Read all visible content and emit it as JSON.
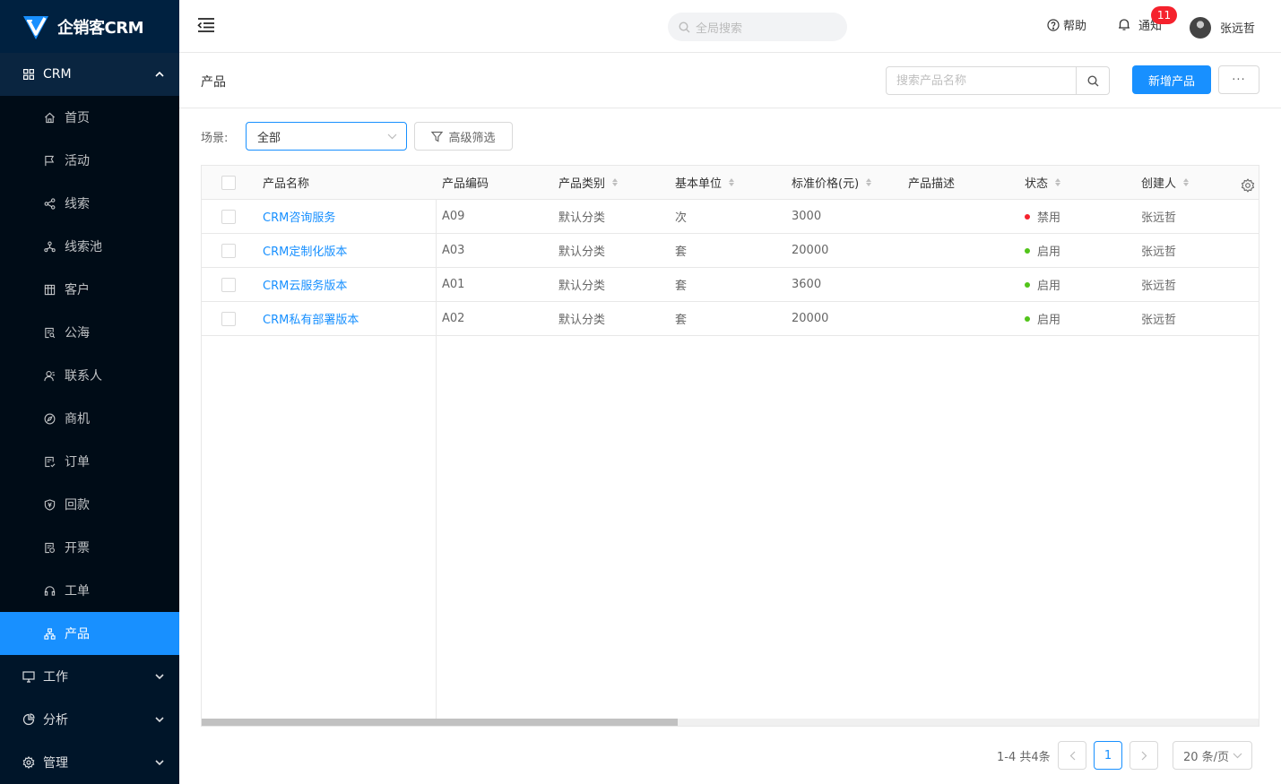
{
  "app": {
    "name": "企销客CRM"
  },
  "sidebar": {
    "crm_group": {
      "label": "CRM",
      "expanded": true
    },
    "items": [
      {
        "label": "首页",
        "icon": "home-icon"
      },
      {
        "label": "活动",
        "icon": "flag-icon"
      },
      {
        "label": "线索",
        "icon": "share-icon"
      },
      {
        "label": "线索池",
        "icon": "cluster-icon"
      },
      {
        "label": "客户",
        "icon": "table-icon"
      },
      {
        "label": "公海",
        "icon": "doc-search-icon"
      },
      {
        "label": "联系人",
        "icon": "contacts-icon"
      },
      {
        "label": "商机",
        "icon": "compass-icon"
      },
      {
        "label": "订单",
        "icon": "order-icon"
      },
      {
        "label": "回款",
        "icon": "shield-yen-icon"
      },
      {
        "label": "开票",
        "icon": "invoice-icon"
      },
      {
        "label": "工单",
        "icon": "headset-icon"
      },
      {
        "label": "产品",
        "icon": "product-icon",
        "active": true
      }
    ],
    "groups": [
      {
        "label": "工作",
        "icon": "desktop-icon"
      },
      {
        "label": "分析",
        "icon": "pie-chart-icon"
      },
      {
        "label": "管理",
        "icon": "gear-icon"
      }
    ]
  },
  "header": {
    "search_placeholder": "全局搜索",
    "help_label": "帮助",
    "notify_label": "通知",
    "notify_count": "11",
    "user_name": "张远哲"
  },
  "page": {
    "title": "产品",
    "search_placeholder": "搜索产品名称",
    "add_button": "新增产品",
    "more_button": "···"
  },
  "filter": {
    "scene_label": "场景:",
    "scene_value": "全部",
    "advanced_label": "高级筛选"
  },
  "table": {
    "columns": [
      "产品名称",
      "产品编码",
      "产品类别",
      "基本单位",
      "标准价格(元)",
      "产品描述",
      "状态",
      "创建人"
    ],
    "rows": [
      {
        "name": "CRM咨询服务",
        "code": "A09",
        "category": "默认分类",
        "unit": "次",
        "price": "3000",
        "desc": "",
        "status": "禁用",
        "status_color": "#f5222d",
        "creator": "张远哲"
      },
      {
        "name": "CRM定制化版本",
        "code": "A03",
        "category": "默认分类",
        "unit": "套",
        "price": "20000",
        "desc": "",
        "status": "启用",
        "status_color": "#52c41a",
        "creator": "张远哲"
      },
      {
        "name": "CRM云服务版本",
        "code": "A01",
        "category": "默认分类",
        "unit": "套",
        "price": "3600",
        "desc": "",
        "status": "启用",
        "status_color": "#52c41a",
        "creator": "张远哲"
      },
      {
        "name": "CRM私有部署版本",
        "code": "A02",
        "category": "默认分类",
        "unit": "套",
        "price": "20000",
        "desc": "",
        "status": "启用",
        "status_color": "#52c41a",
        "creator": "张远哲"
      }
    ]
  },
  "pagination": {
    "total_text": "1-4 共4条",
    "current_page": "1",
    "page_size": "20 条/页"
  },
  "colors": {
    "sidebar_bg": "#001529",
    "primary": "#1890ff",
    "disabled_dot": "#f5222d",
    "enabled_dot": "#52c41a"
  }
}
